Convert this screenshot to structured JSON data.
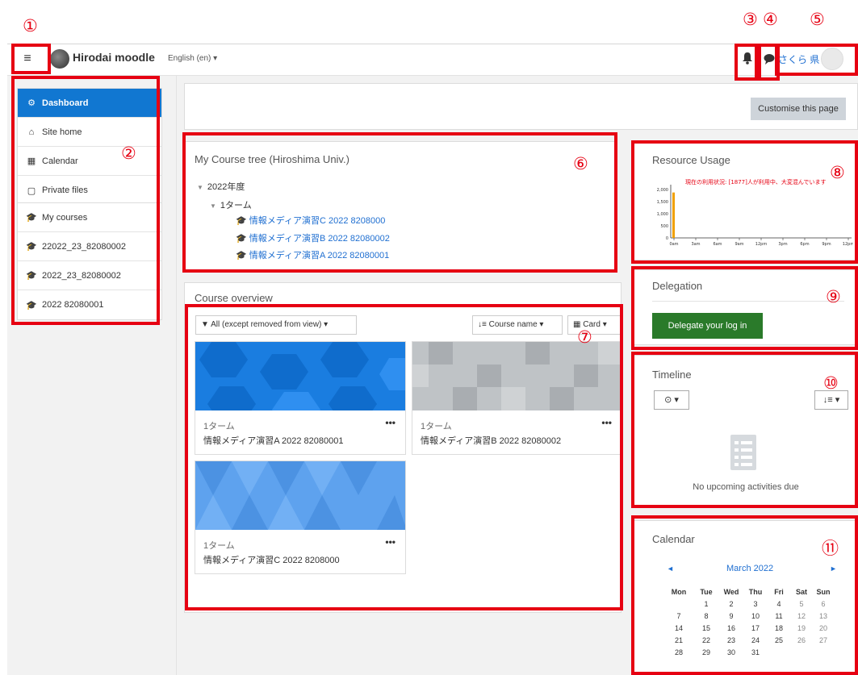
{
  "annotations": [
    "①",
    "②",
    "③",
    "④",
    "⑤",
    "⑥",
    "⑦",
    "⑧",
    "⑨",
    "⑩",
    "⑪"
  ],
  "navbar": {
    "menu_glyph": "≡",
    "site_name": "Hirodai moodle",
    "language": "English (en) ▾",
    "user_name": "さくら 県"
  },
  "sidebar": {
    "items": [
      {
        "label": "Dashboard",
        "icon": "dashboard-icon",
        "glyph": "⚙"
      },
      {
        "label": "Site home",
        "icon": "home-icon",
        "glyph": "⌂"
      },
      {
        "label": "Calendar",
        "icon": "calendar-icon",
        "glyph": "▦"
      },
      {
        "label": "Private files",
        "icon": "file-icon",
        "glyph": "▢"
      },
      {
        "label": "My courses",
        "icon": "graduation-cap-icon",
        "glyph": "🎓"
      },
      {
        "label": "22022_23_82080002",
        "icon": "graduation-cap-icon",
        "glyph": "🎓"
      },
      {
        "label": "2022_23_82080002",
        "icon": "graduation-cap-icon",
        "glyph": "🎓"
      },
      {
        "label": "2022 82080001",
        "icon": "graduation-cap-icon",
        "glyph": "🎓"
      }
    ]
  },
  "page": {
    "customise_label": "Customise this page"
  },
  "course_tree": {
    "title": "My Course tree (Hiroshima Univ.)",
    "year": "2022年度",
    "term": "1ターム",
    "courses": [
      "情報メディア演習C 2022 8208000",
      "情報メディア演習B 2022 82080002",
      "情報メディア演習A 2022 82080001"
    ]
  },
  "course_overview": {
    "title": "Course overview",
    "filter_label": "All (except removed from view) ▾",
    "sort_label": "Course name ▾",
    "view_label": "Card ▾",
    "cards": [
      {
        "category": "1ターム",
        "name": "情報メディア演習A 2022 82080001",
        "more": "•••"
      },
      {
        "category": "1ターム",
        "name": "情報メディア演習B 2022 82080002",
        "more": "•••"
      },
      {
        "category": "1ターム",
        "name": "情報メディア演習C 2022 8208000",
        "more": "•••"
      }
    ]
  },
  "resource_usage": {
    "title": "Resource Usage",
    "status_text": "現在の利用状況: [1877]人が利用中、大変混んでいます"
  },
  "chart_data": {
    "type": "bar",
    "title": "現在の利用状況: [1877]人が利用中、大変混んでいます",
    "xlabel": "",
    "ylabel": "",
    "categories": [
      "0am",
      "3am",
      "6am",
      "9am",
      "12pm",
      "3pm",
      "6pm",
      "9pm",
      "12pm"
    ],
    "values": [
      1877,
      0,
      0,
      0,
      0,
      0,
      0,
      0,
      0
    ],
    "y_ticks": [
      "2,000",
      "1,500",
      "1,000",
      "500",
      "0"
    ],
    "ylim": [
      0,
      2000
    ],
    "bar_color": "#f0a000"
  },
  "delegation": {
    "title": "Delegation",
    "button_label": "Delegate your log in",
    "button_color": "#2a7a2a"
  },
  "timeline": {
    "title": "Timeline",
    "filter_label": "⊙ ▾",
    "sort_label": "↓≡ ▾",
    "empty_text": "No upcoming activities due"
  },
  "calendar": {
    "title": "Calendar",
    "month": "March 2022",
    "prev": "◄",
    "next": "►",
    "weekdays": [
      "Mon",
      "Tue",
      "Wed",
      "Thu",
      "Fri",
      "Sat",
      "Sun"
    ],
    "weeks": [
      [
        "",
        "1",
        "2",
        "3",
        "4",
        "5",
        "6"
      ],
      [
        "7",
        "8",
        "9",
        "10",
        "11",
        "12",
        "13"
      ],
      [
        "14",
        "15",
        "16",
        "17",
        "18",
        "19",
        "20"
      ],
      [
        "21",
        "22",
        "23",
        "24",
        "25",
        "26",
        "27"
      ],
      [
        "28",
        "29",
        "30",
        "31",
        "",
        "",
        ""
      ]
    ]
  },
  "colors": {
    "annotation_red": "#e60012",
    "active_blue": "#1177d1",
    "link_blue": "#1f6fd1"
  }
}
